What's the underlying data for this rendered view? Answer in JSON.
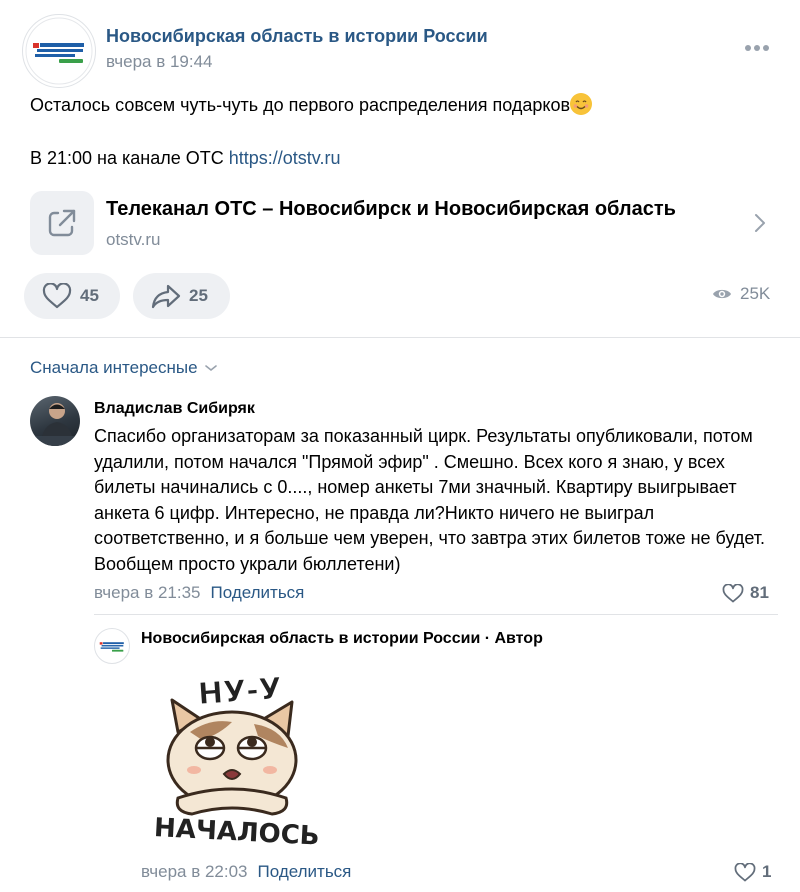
{
  "post": {
    "group_name": "Новосибирская область в истории России",
    "time": "вчера в 19:44",
    "text_line1": "Осталось совсем чуть-чуть до первого распределения подарков",
    "text_line2_prefix": "В 21:00 на канале ОТС ",
    "text_line2_link": "https://otstv.ru",
    "emoji": "smiling-face-emoji"
  },
  "link_card": {
    "title": "Телеканал ОТС – Новосибирск и Новосибирская область",
    "domain": "otstv.ru",
    "icon": "external-link-icon"
  },
  "actions": {
    "likes": "45",
    "shares": "25",
    "views": "25K"
  },
  "comments": {
    "sort_label": "Сначала интересные",
    "items": [
      {
        "author": "Владислав Сибиряк",
        "text": "Спасибо организаторам за показанный цирк. Результаты опубликовали, потом удалили, потом начался \"Прямой эфир\" . Смешно. Всех кого я знаю, у всех билеты начинались с 0...., номер анкеты 7ми значный. Квартиру выигрывает анкета 6 цифр. Интересно, не правда ли?Никто ничего не выиграл соответственно, и я больше чем уверен, что завтра этих билетов тоже не будет. Вообщем просто украли бюллетени)",
        "time": "вчера в 21:35",
        "share_label": "Поделиться",
        "likes": "81"
      }
    ],
    "reply": {
      "author": "Новосибирская область в истории России · Автор",
      "sticker_text_top": "НУ-У",
      "sticker_text_bottom": "НАЧАЛОСЬ",
      "time": "вчера в 22:03",
      "share_label": "Поделиться",
      "likes": "1"
    }
  },
  "colors": {
    "link": "#2a5885",
    "secondary": "#818c99",
    "pill_bg": "#eef0f3",
    "divider": "#e1e3e6"
  }
}
